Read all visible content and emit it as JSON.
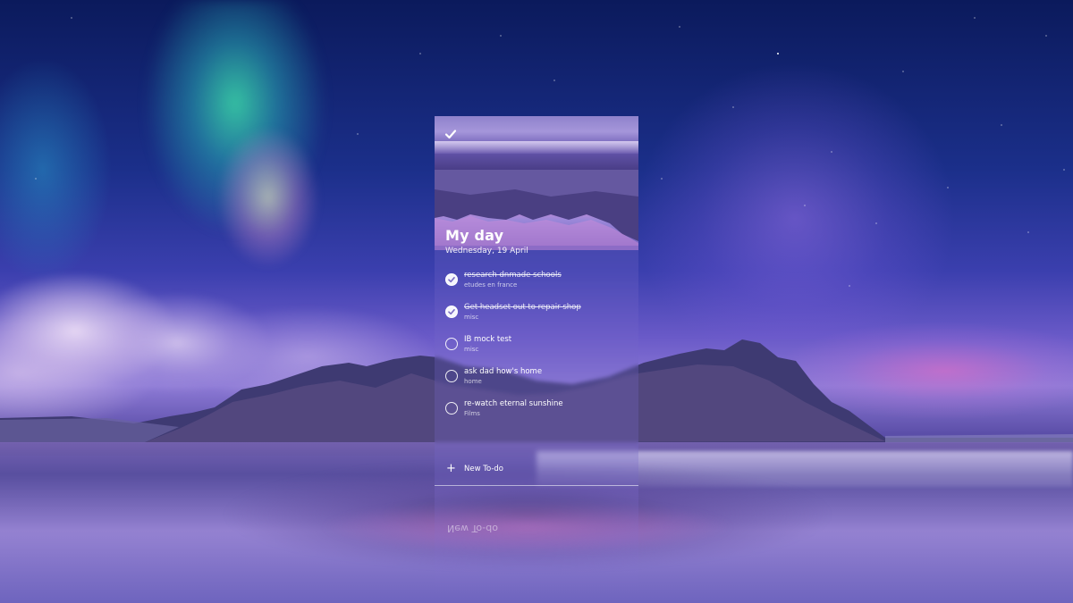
{
  "app": {
    "title": "My day",
    "date": "Wednesday, 19 April",
    "logo_icon": "checkmark-icon"
  },
  "tasks": [
    {
      "title": "research dnmade schools",
      "list": "etudes en france",
      "completed": true
    },
    {
      "title": "Get headset out to repair shop",
      "list": "misc",
      "completed": true
    },
    {
      "title": "IB mock test",
      "list": "misc",
      "completed": false
    },
    {
      "title": "ask dad how's home",
      "list": "home",
      "completed": false
    },
    {
      "title": "re-watch eternal sunshine",
      "list": "Films",
      "completed": false
    }
  ],
  "new_todo": {
    "icon": "plus-icon",
    "label": "New To-do"
  },
  "colors": {
    "panel_tint": "#7869c8",
    "text": "#ffffff"
  }
}
